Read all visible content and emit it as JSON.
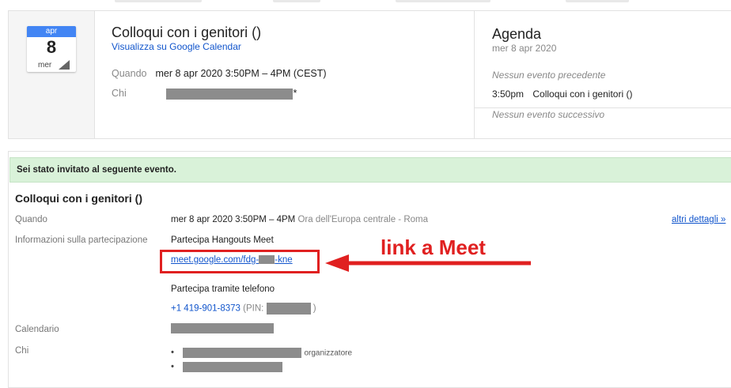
{
  "event_card": {
    "date_month": "apr",
    "date_day": "8",
    "date_weekday": "mer",
    "title": "Colloqui con i genitori ()",
    "view_link": "Visualizza su Google Calendar",
    "when_label": "Quando",
    "when_value": "mer 8 apr 2020 3:50PM – 4PM (CEST)",
    "who_label": "Chi",
    "who_suffix": "*"
  },
  "agenda": {
    "title": "Agenda",
    "date": "mer 8 apr 2020",
    "no_previous": "Nessun evento precedente",
    "event_time": "3:50pm",
    "event_title": "Colloqui con i genitori ()",
    "no_next": "Nessun evento successivo"
  },
  "invite": {
    "banner": "Sei stato invitato al seguente evento.",
    "title": "Colloqui con i genitori ()",
    "when_label": "Quando",
    "when_value": "mer 8 apr 2020 3:50PM – 4PM",
    "when_tz": "Ora dell'Europa centrale - Roma",
    "more_details": "altri dettagli »",
    "participation_label": "Informazioni sulla partecipazione",
    "hangouts": "Partecipa Hangouts Meet",
    "meet_link_start": "meet.google.com/fdg-",
    "meet_link_end": "-kne",
    "phone_label": "Partecipa tramite telefono",
    "phone_number": "+1 419-901-8373",
    "pin_label": "(PIN:",
    "pin_close": ")",
    "calendar_label": "Calendario",
    "who_label": "Chi",
    "organizer": "organizzatore",
    "bullet": "•"
  },
  "annotation": {
    "text": "link a Meet",
    "color": "#e02020"
  }
}
